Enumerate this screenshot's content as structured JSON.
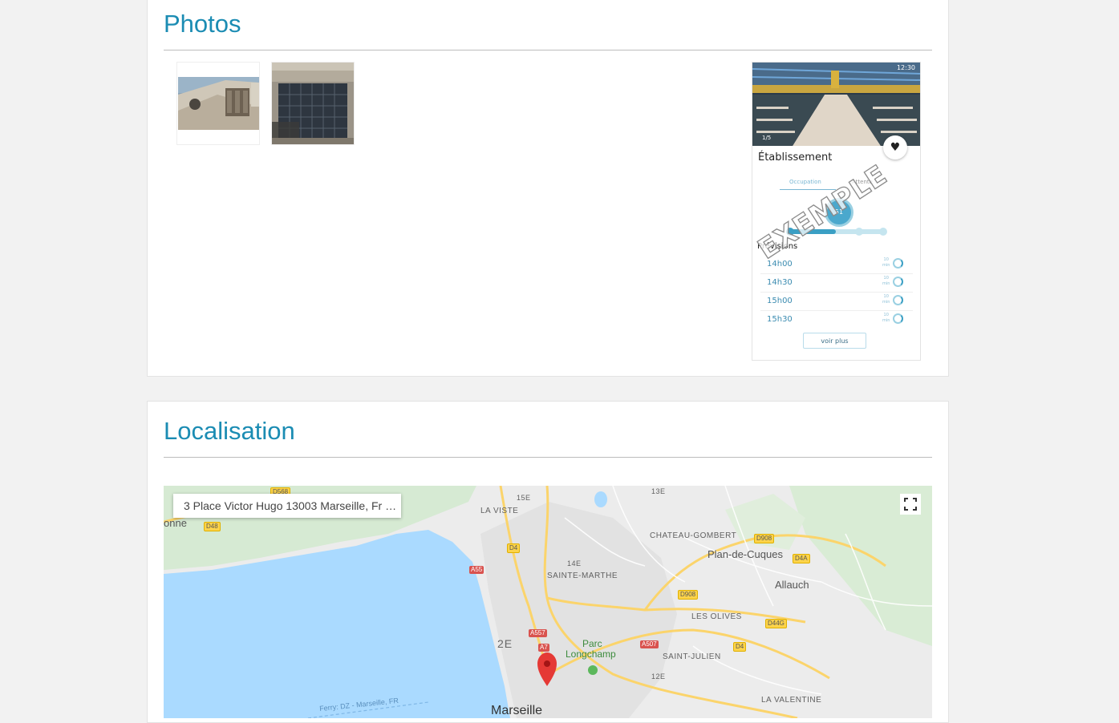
{
  "photos": {
    "title": "Photos",
    "thumbnails": [
      {
        "name": "Photo 1"
      },
      {
        "name": "Photo 2"
      }
    ]
  },
  "app_preview": {
    "status_time": "12:30",
    "photo_counter": "1/5",
    "establishment_label": "Établissement",
    "tabs": [
      "Occupation",
      "Attente"
    ],
    "slider_value": "51",
    "slider_level": 0.5,
    "forecast_title": "Prévisions",
    "forecasts": [
      {
        "time": "14h00",
        "value": "10",
        "unit": "min"
      },
      {
        "time": "14h30",
        "value": "10",
        "unit": "min"
      },
      {
        "time": "15h00",
        "value": "10",
        "unit": "min"
      },
      {
        "time": "15h30",
        "value": "10",
        "unit": "min"
      }
    ],
    "more_button": "voir plus",
    "watermark": "EXEMPLE"
  },
  "localisation": {
    "title": "Localisation",
    "address": "3 Place Victor Hugo 13003 Marseille, Fr …",
    "map_labels": {
      "la_viste": "LA VISTE",
      "sainte_marthe": "SAINTE-MARTHE",
      "chateau_gombert": "CHATEAU-GOMBERT",
      "plan_de_cuques": "Plan-de-Cuques",
      "allauch": "Allauch",
      "les_olives": "LES OLIVES",
      "saint_julien": "SAINT-JULIEN",
      "la_valentine": "LA VALENTINE",
      "parc": "Parc",
      "longchamp": "Longchamp",
      "onne": "onne",
      "e15": "15E",
      "e13": "13E",
      "e14": "14E",
      "e12": "12E",
      "e2": "2E",
      "marseille_cut": "Marseille",
      "ferry": "Ferry: DZ - Marseille, FR"
    },
    "roads": {
      "d568": "D568",
      "d48": "D48",
      "d4_1": "D4",
      "a55": "A55",
      "d908_1": "D908",
      "d908_2": "D908",
      "d4a": "D4A",
      "d44g": "D44G",
      "d4_2": "D4",
      "a557": "A557",
      "a7": "A7",
      "a507": "A507"
    }
  }
}
